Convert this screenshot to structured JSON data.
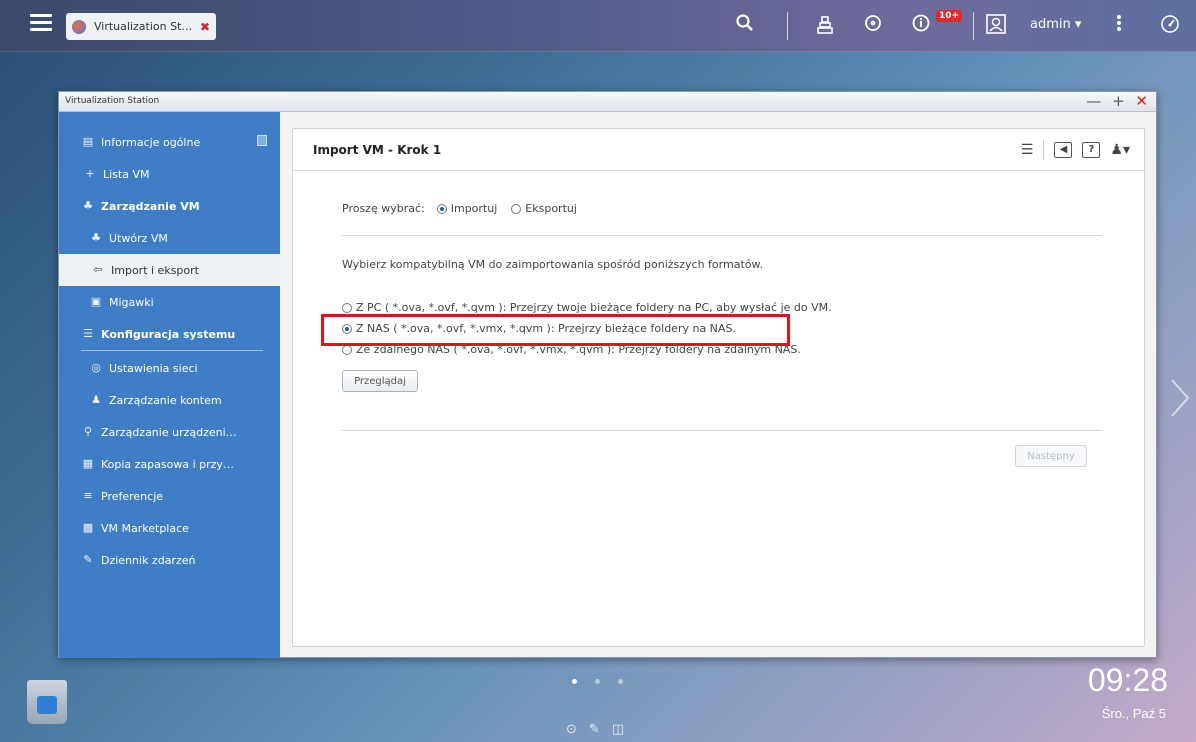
{
  "topbar": {
    "tab_label": "Virtualization St…",
    "tab_close": "✖",
    "notification_badge": "10+",
    "user": "admin ▾"
  },
  "window": {
    "title": "Virtualization Station",
    "controls": {
      "minimize": "—",
      "maximize": "+",
      "close": "✕"
    }
  },
  "sidebar": {
    "items": [
      {
        "label": "Informacje ogólne",
        "icon": "info-icon",
        "bold": false
      },
      {
        "label": "Lista VM",
        "icon": "plus-icon",
        "bold": false
      },
      {
        "label": "Zarządzanie VM",
        "icon": "vm-manage-icon",
        "bold": true
      },
      {
        "label": "Utwórz VM",
        "icon": "create-vm-icon",
        "bold": false
      },
      {
        "label": "Import i eksport",
        "icon": "import-export-icon",
        "bold": false,
        "active": true
      },
      {
        "label": "Migawki",
        "icon": "snapshot-icon",
        "bold": false
      },
      {
        "label": "Konfiguracja systemu",
        "icon": "config-icon",
        "bold": true
      },
      {
        "label": "Ustawienia sieci",
        "icon": "network-icon",
        "bold": false
      },
      {
        "label": "Zarządzanie kontem",
        "icon": "account-icon",
        "bold": false
      },
      {
        "label": "Zarządzanie urządzeni…",
        "icon": "device-icon",
        "bold": false
      },
      {
        "label": "Kopia zapasowa i przy…",
        "icon": "backup-icon",
        "bold": false
      },
      {
        "label": "Preferencje",
        "icon": "preferences-icon",
        "bold": false
      },
      {
        "label": "VM Marketplace",
        "icon": "marketplace-icon",
        "bold": false
      },
      {
        "label": "Dziennik zdarzeń",
        "icon": "log-icon",
        "bold": false
      }
    ]
  },
  "main": {
    "header_title": "Import VM - Krok 1",
    "choose_label": "Proszę wybrać:",
    "mode_import": "Importuj",
    "mode_export": "Eksportuj",
    "instruction": "Wybierz kompatybilną VM do zaimportowania spośród poniższych formatów.",
    "option_pc": "Z PC ( *.ova, *.ovf, *.qvm ): Przejrzy twoje bieżące foldery na PC, aby wysłać je do VM.",
    "option_nas": "Z NAS ( *.ova, *.ovf, *.vmx, *.qvm ): Przejrzy bieżące foldery na NAS.",
    "option_remote": "Ze zdalnego NAS ( *.ova, *.ovf, *.vmx, *.qvm ): Przejrzy foldery na zdalnym NAS.",
    "browse_button": "Przeglądaj",
    "next_button": "Następny",
    "selected_mode": "Importuj",
    "selected_option": "Z NAS"
  },
  "desktop": {
    "time": "09:28",
    "date": "Śro., Paź 5"
  },
  "colors": {
    "sidebar": "#3f7ec7",
    "highlight": "#e0121a",
    "badge": "#e02a2a"
  }
}
